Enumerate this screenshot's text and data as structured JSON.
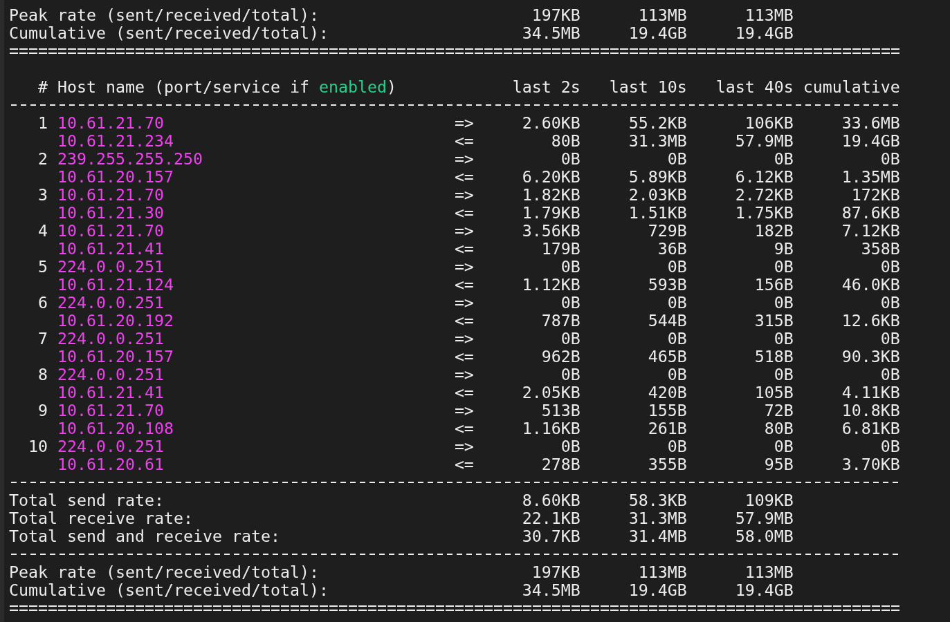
{
  "top_summary": [
    {
      "label": "Peak rate (sent/received/total):",
      "values": [
        "197KB",
        "113MB",
        "113MB"
      ]
    },
    {
      "label": "Cumulative (sent/received/total):",
      "values": [
        "34.5MB",
        "19.4GB",
        "19.4GB"
      ]
    }
  ],
  "header": {
    "before": "# Host name (port/service if ",
    "highlight": "enabled",
    "after": ")",
    "columns": [
      "last 2s",
      "last 10s",
      "last 40s",
      "cumulative"
    ]
  },
  "connections": [
    {
      "rank": "1",
      "sent": {
        "host": "10.61.21.70",
        "direction": "=>",
        "values": [
          "2.60KB",
          "55.2KB",
          "106KB",
          "33.6MB"
        ]
      },
      "received": {
        "host": "10.61.21.234",
        "direction": "<=",
        "values": [
          "80B",
          "31.3MB",
          "57.9MB",
          "19.4GB"
        ]
      }
    },
    {
      "rank": "2",
      "sent": {
        "host": "239.255.255.250",
        "direction": "=>",
        "values": [
          "0B",
          "0B",
          "0B",
          "0B"
        ]
      },
      "received": {
        "host": "10.61.20.157",
        "direction": "<=",
        "values": [
          "6.20KB",
          "5.89KB",
          "6.12KB",
          "1.35MB"
        ]
      }
    },
    {
      "rank": "3",
      "sent": {
        "host": "10.61.21.70",
        "direction": "=>",
        "values": [
          "1.82KB",
          "2.03KB",
          "2.72KB",
          "172KB"
        ]
      },
      "received": {
        "host": "10.61.21.30",
        "direction": "<=",
        "values": [
          "1.79KB",
          "1.51KB",
          "1.75KB",
          "87.6KB"
        ]
      }
    },
    {
      "rank": "4",
      "sent": {
        "host": "10.61.21.70",
        "direction": "=>",
        "values": [
          "3.56KB",
          "729B",
          "182B",
          "7.12KB"
        ]
      },
      "received": {
        "host": "10.61.21.41",
        "direction": "<=",
        "values": [
          "179B",
          "36B",
          "9B",
          "358B"
        ]
      }
    },
    {
      "rank": "5",
      "sent": {
        "host": "224.0.0.251",
        "direction": "=>",
        "values": [
          "0B",
          "0B",
          "0B",
          "0B"
        ]
      },
      "received": {
        "host": "10.61.21.124",
        "direction": "<=",
        "values": [
          "1.12KB",
          "593B",
          "156B",
          "46.0KB"
        ]
      }
    },
    {
      "rank": "6",
      "sent": {
        "host": "224.0.0.251",
        "direction": "=>",
        "values": [
          "0B",
          "0B",
          "0B",
          "0B"
        ]
      },
      "received": {
        "host": "10.61.20.192",
        "direction": "<=",
        "values": [
          "787B",
          "544B",
          "315B",
          "12.6KB"
        ]
      }
    },
    {
      "rank": "7",
      "sent": {
        "host": "224.0.0.251",
        "direction": "=>",
        "values": [
          "0B",
          "0B",
          "0B",
          "0B"
        ]
      },
      "received": {
        "host": "10.61.20.157",
        "direction": "<=",
        "values": [
          "962B",
          "465B",
          "518B",
          "90.3KB"
        ]
      }
    },
    {
      "rank": "8",
      "sent": {
        "host": "224.0.0.251",
        "direction": "=>",
        "values": [
          "0B",
          "0B",
          "0B",
          "0B"
        ]
      },
      "received": {
        "host": "10.61.21.41",
        "direction": "<=",
        "values": [
          "2.05KB",
          "420B",
          "105B",
          "4.11KB"
        ]
      }
    },
    {
      "rank": "9",
      "sent": {
        "host": "10.61.21.70",
        "direction": "=>",
        "values": [
          "513B",
          "155B",
          "72B",
          "10.8KB"
        ]
      },
      "received": {
        "host": "10.61.20.108",
        "direction": "<=",
        "values": [
          "1.16KB",
          "261B",
          "80B",
          "6.81KB"
        ]
      }
    },
    {
      "rank": "10",
      "sent": {
        "host": "224.0.0.251",
        "direction": "=>",
        "values": [
          "0B",
          "0B",
          "0B",
          "0B"
        ]
      },
      "received": {
        "host": "10.61.20.61",
        "direction": "<=",
        "values": [
          "278B",
          "355B",
          "95B",
          "3.70KB"
        ]
      }
    }
  ],
  "totals": [
    {
      "label": "Total send rate:",
      "values": [
        "8.60KB",
        "58.3KB",
        "109KB"
      ]
    },
    {
      "label": "Total receive rate:",
      "values": [
        "22.1KB",
        "31.3MB",
        "57.9MB"
      ]
    },
    {
      "label": "Total send and receive rate:",
      "values": [
        "30.7KB",
        "31.4MB",
        "58.0MB"
      ]
    }
  ],
  "bottom_summary": [
    {
      "label": "Peak rate (sent/received/total):",
      "values": [
        "197KB",
        "113MB",
        "113MB"
      ]
    },
    {
      "label": "Cumulative (sent/received/total):",
      "values": [
        "34.5MB",
        "19.4GB",
        "19.4GB"
      ]
    }
  ]
}
